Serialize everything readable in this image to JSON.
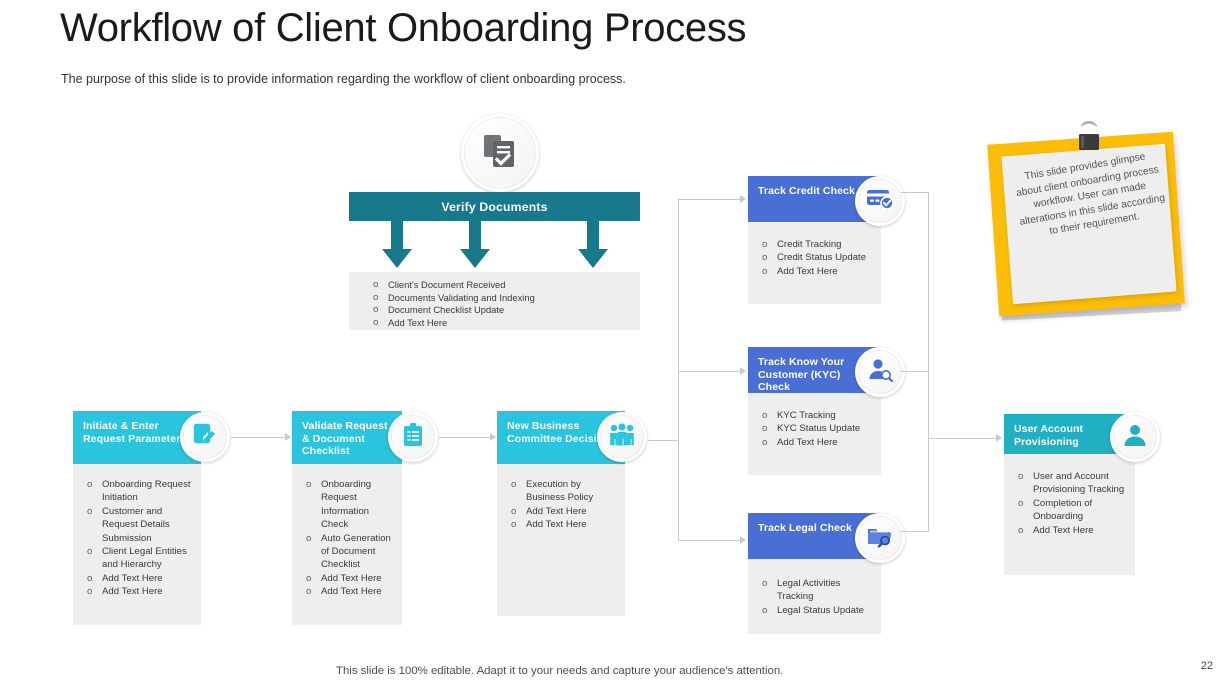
{
  "header": {
    "title": "Workflow of Client Onboarding Process",
    "subtitle": "The purpose of this slide is to provide information regarding the workflow of client onboarding process."
  },
  "colors": {
    "teal_dark": "#18798c",
    "cyan": "#2bc4de",
    "teal_mid": "#21afc4",
    "blue": "#4a6fd4",
    "body_gray": "#eeeeee",
    "sticky_yellow": "#fbbd08",
    "connector": "#c9c9c9"
  },
  "verify": {
    "title": "Verify Documents",
    "icon": "documents-check-icon",
    "bullets": [
      "Client's Document Received",
      "Documents Validating  and Indexing",
      "Document Checklist  Update",
      "Add Text Here"
    ]
  },
  "steps": [
    {
      "id": "initiate",
      "title": "Initiate & Enter Request Parameters",
      "icon": "edit-document-icon",
      "color": "cyan",
      "bullets": [
        "Onboarding Request Initiation",
        "Customer and Request Details Submission",
        "Client Legal Entities and Hierarchy",
        "Add Text Here",
        "Add Text Here"
      ]
    },
    {
      "id": "validate",
      "title": "Validate Request & Document Checklist",
      "icon": "clipboard-checklist-icon",
      "color": "cyan",
      "bullets": [
        "Onboarding Request Information  Check",
        "Auto Generation of Document Checklist",
        "Add Text Here",
        "Add Text Here"
      ]
    },
    {
      "id": "committee",
      "title": "New Business Committee Decision",
      "icon": "people-group-icon",
      "color": "cyan",
      "bullets": [
        "Execution by Business Policy",
        "Add Text Here",
        "Add Text Here"
      ]
    }
  ],
  "tracks": [
    {
      "id": "credit",
      "title": "Track Credit Check",
      "icon": "credit-card-check-icon",
      "color": "blue",
      "bullets": [
        "Credit Tracking",
        "Credit Status Update",
        "Add Text Here"
      ]
    },
    {
      "id": "kyc",
      "title": "Track Know Your Customer (KYC) Check",
      "icon": "user-search-icon",
      "color": "blue",
      "bullets": [
        "KYC Tracking",
        "KYC Status  Update",
        "Add Text Here"
      ]
    },
    {
      "id": "legal",
      "title": "Track Legal Check",
      "icon": "folder-search-icon",
      "color": "blue",
      "bullets": [
        "Legal Activities Tracking",
        "Legal Status Update"
      ]
    }
  ],
  "final": {
    "id": "provisioning",
    "title": "User Account Provisioning",
    "icon": "user-account-icon",
    "color": "teal_mid",
    "bullets": [
      "User and Account Provisioning Tracking",
      "Completion of Onboarding",
      "Add Text Here"
    ]
  },
  "sticky": {
    "icon": "binder-clip-icon",
    "text": "This slide provides glimpse about client onboarding process workflow. User can made alterations in this slide according to their requirement."
  },
  "footer": {
    "note": "This slide is 100% editable. Adapt it to your needs and capture your audience's attention.",
    "page_number": "22"
  }
}
